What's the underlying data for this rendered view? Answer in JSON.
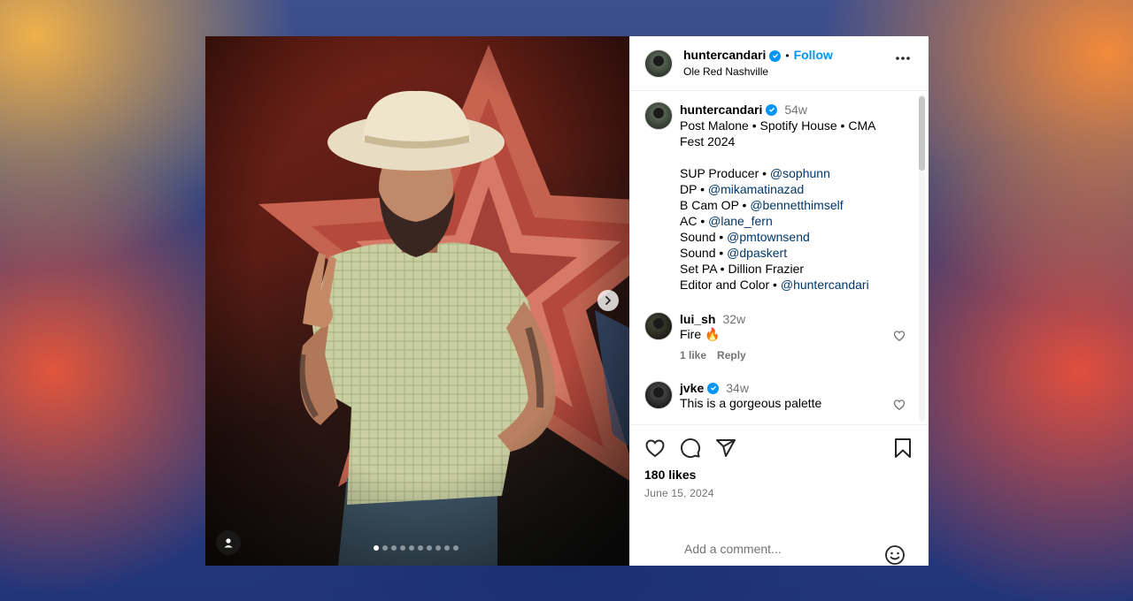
{
  "post": {
    "author": "huntercandari",
    "follow_label": "Follow",
    "location": "Ole Red Nashville",
    "bullet": "•"
  },
  "caption": {
    "author": "huntercandari",
    "time": "54w",
    "title_line1": "Post Malone • Spotify House • CMA",
    "title_line2": "Fest 2024",
    "credits": [
      {
        "role": "SUP Producer •",
        "handle": "@sophunn"
      },
      {
        "role": "DP •",
        "handle": "@mikamatinazad"
      },
      {
        "role": "B Cam OP •",
        "handle": "@bennetthimself"
      },
      {
        "role": "AC •",
        "handle": "@lane_fern"
      },
      {
        "role": "Sound •",
        "handle": "@pmtownsend"
      },
      {
        "role": "Sound •",
        "handle": "@dpaskert"
      },
      {
        "role": "Set PA • Dillion Frazier",
        "handle": ""
      },
      {
        "role": "Editor and Color •",
        "handle": "@huntercandari"
      }
    ]
  },
  "comments": [
    {
      "user": "lui_sh",
      "time": "32w",
      "text": "Fire 🔥",
      "likes": "1 like",
      "reply": "Reply",
      "verified": false
    },
    {
      "user": "jvke",
      "time": "34w",
      "text": "This is a gorgeous palette",
      "likes": "",
      "reply": "",
      "verified": true
    }
  ],
  "engagement": {
    "likes": "180 likes",
    "date": "June 15, 2024"
  },
  "composer": {
    "placeholder": "Add a comment..."
  },
  "carousel": {
    "total": 10,
    "current": 1
  },
  "icons": {
    "more": "more-horizontal-icon",
    "like": "heart-icon",
    "comment": "comment-icon",
    "share": "paper-plane-icon",
    "save": "bookmark-icon",
    "emoji": "smiley-icon",
    "next": "chevron-right-icon",
    "tags": "user-tag-icon",
    "verified": "verified-badge-icon"
  },
  "colors": {
    "link": "#00376b",
    "follow": "#0095f6",
    "verified": "#0095f6",
    "muted": "#737373"
  }
}
